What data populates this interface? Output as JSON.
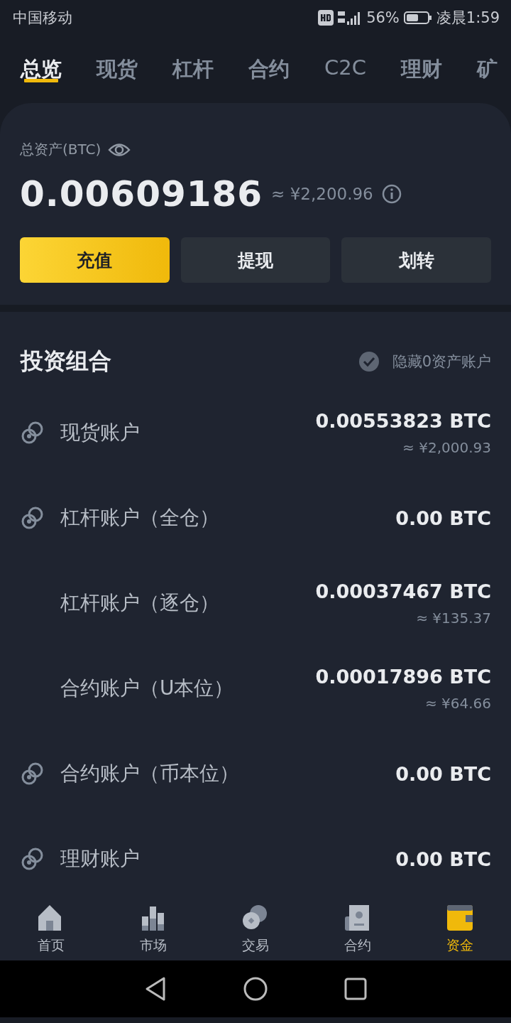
{
  "status_bar": {
    "carrier": "中国移动",
    "battery": "56%",
    "time": "凌晨1:59"
  },
  "tabs": [
    {
      "label": "总览",
      "selected": true
    },
    {
      "label": "现货",
      "selected": false
    },
    {
      "label": "杠杆",
      "selected": false
    },
    {
      "label": "合约",
      "selected": false
    },
    {
      "label": "C2C",
      "selected": false
    },
    {
      "label": "理财",
      "selected": false
    },
    {
      "label": "矿",
      "selected": false
    }
  ],
  "summary": {
    "label": "总资产(BTC)",
    "total": "0.00609186",
    "fiat": "≈ ¥2,200.96",
    "buttons": [
      {
        "label": "充值",
        "kind": "primary"
      },
      {
        "label": "提现",
        "kind": "secondary"
      },
      {
        "label": "划转",
        "kind": "secondary"
      }
    ]
  },
  "portfolio": {
    "title": "投资组合",
    "hide_zero": {
      "label": "隐藏0资产账户",
      "checked": true
    },
    "accounts": [
      {
        "name": "现货账户",
        "icon": true,
        "amount": "0.00553823 BTC",
        "fiat": "≈ ¥2,000.93"
      },
      {
        "name": "杠杆账户（全仓）",
        "icon": true,
        "amount": "0.00 BTC"
      },
      {
        "name": "杠杆账户（逐仓）",
        "icon": false,
        "amount": "0.00037467 BTC",
        "fiat": "≈ ¥135.37"
      },
      {
        "name": "合约账户（U本位）",
        "icon": false,
        "amount": "0.00017896 BTC",
        "fiat": "≈ ¥64.66"
      },
      {
        "name": "合约账户（币本位）",
        "icon": true,
        "amount": "0.00 BTC"
      },
      {
        "name": "理财账户",
        "icon": true,
        "amount": "0.00 BTC"
      }
    ]
  },
  "bottom_nav": [
    {
      "label": "首页",
      "kind": "home",
      "selected": false
    },
    {
      "label": "市场",
      "kind": "market",
      "selected": false
    },
    {
      "label": "交易",
      "kind": "trade",
      "selected": false
    },
    {
      "label": "合约",
      "kind": "futures",
      "selected": false
    },
    {
      "label": "资金",
      "kind": "wallet",
      "selected": true
    }
  ]
}
